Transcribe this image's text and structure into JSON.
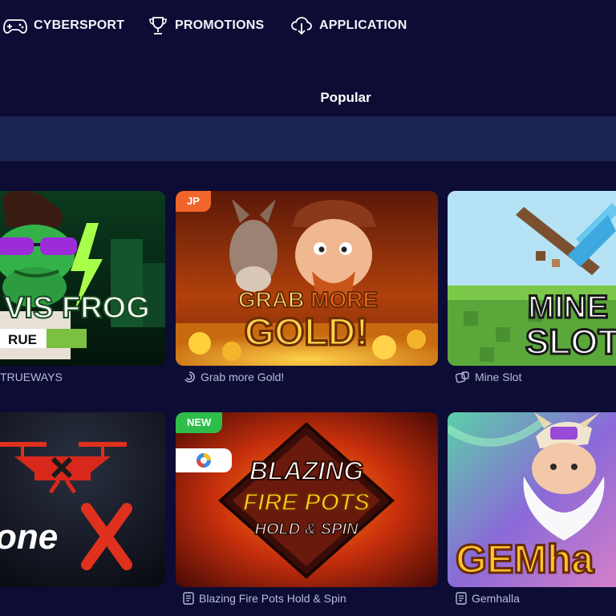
{
  "nav": {
    "items": [
      {
        "label": "CYBERSPORT",
        "icon": "gamepad-icon"
      },
      {
        "label": "PROMOTIONS",
        "icon": "trophy-icon"
      },
      {
        "label": "APPLICATION",
        "icon": "download-cloud-icon"
      }
    ]
  },
  "section": {
    "title": "Popular"
  },
  "games": [
    {
      "caption": "TRUEWAYS",
      "art_text": [
        "VIS FROG",
        "RUE"
      ],
      "badge": ""
    },
    {
      "caption": "Grab more Gold!",
      "art_text": [
        "GRAB",
        "MORE",
        "GOLD!"
      ],
      "badge": "JP",
      "caption_icon": "spiral-icon"
    },
    {
      "caption": "Mine Slot",
      "art_text": [
        "MINE",
        "SLOT"
      ],
      "badge": "",
      "caption_icon": "dice-icon"
    },
    {
      "caption": "",
      "art_text": [
        "one"
      ],
      "badge": ""
    },
    {
      "caption": "Blazing Fire Pots Hold & Spin",
      "art_text": [
        "BLAZING",
        "FIRE POTS",
        "HOLD & SPIN"
      ],
      "badge": "NEW",
      "caption_icon": "provider-icon"
    },
    {
      "caption": "Gemhalla",
      "art_text": [
        "GEMha"
      ],
      "badge": "",
      "caption_icon": "provider-icon"
    }
  ],
  "colors": {
    "background": "#0c0c35",
    "search_bar": "#1a2352",
    "jp_badge": "#f2652a",
    "new_badge": "#2fbd4a",
    "caption_text": "#b8bdd8"
  }
}
